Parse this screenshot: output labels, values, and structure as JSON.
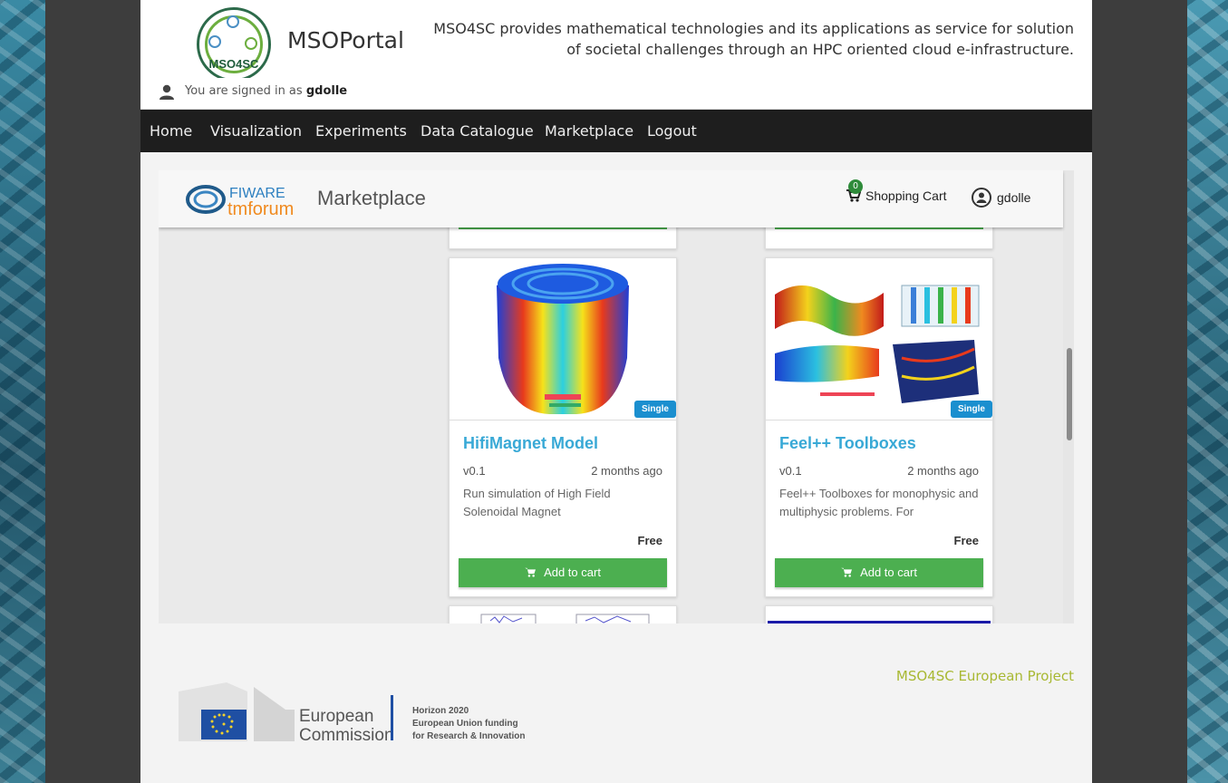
{
  "header": {
    "logo_text": "MSO4SC",
    "brand": "MSOPortal",
    "tagline": "MSO4SC provides mathematical technologies and its applications as service for solution of societal challenges through an HPC oriented cloud e-infrastructure."
  },
  "signed_in": {
    "prefix": "You are signed in as",
    "user": "gdolle"
  },
  "nav": {
    "items": [
      "Home",
      "Visualization",
      "Experiments",
      "Data Catalogue",
      "Marketplace",
      "Logout"
    ]
  },
  "marketplace": {
    "logo_top": "FIWARE",
    "logo_bottom": "tmforum",
    "title": "Marketplace",
    "cart_count": "0",
    "cart_label": "Shopping Cart",
    "account": "gdolle"
  },
  "offerings": [
    {
      "badge": "Single",
      "title": "HifiMagnet Model",
      "version": "v0.1",
      "age": "2 months ago",
      "description": "Run simulation of High Field Solenoidal Magnet",
      "price": "Free",
      "button": "Add to cart"
    },
    {
      "badge": "Single",
      "title": "Feel++ Toolboxes",
      "version": "v0.1",
      "age": "2 months ago",
      "description": "Feel++ Toolboxes for monophysic and multiphysic problems. For",
      "price": "Free",
      "button": "Add to cart"
    }
  ],
  "footer": {
    "link": "MSO4SC European Project",
    "ec_line1": "European",
    "ec_line2": "Commission",
    "h2020_1": "Horizon 2020",
    "h2020_2": "European Union funding",
    "h2020_3": "for Research & Innovation"
  },
  "colors": {
    "nav_bg": "#1e1e1e",
    "title_blue": "#39a9d6",
    "cart_green": "#4caf50",
    "badge_blue": "#1b8fcf",
    "footer_link": "#a8b832"
  }
}
